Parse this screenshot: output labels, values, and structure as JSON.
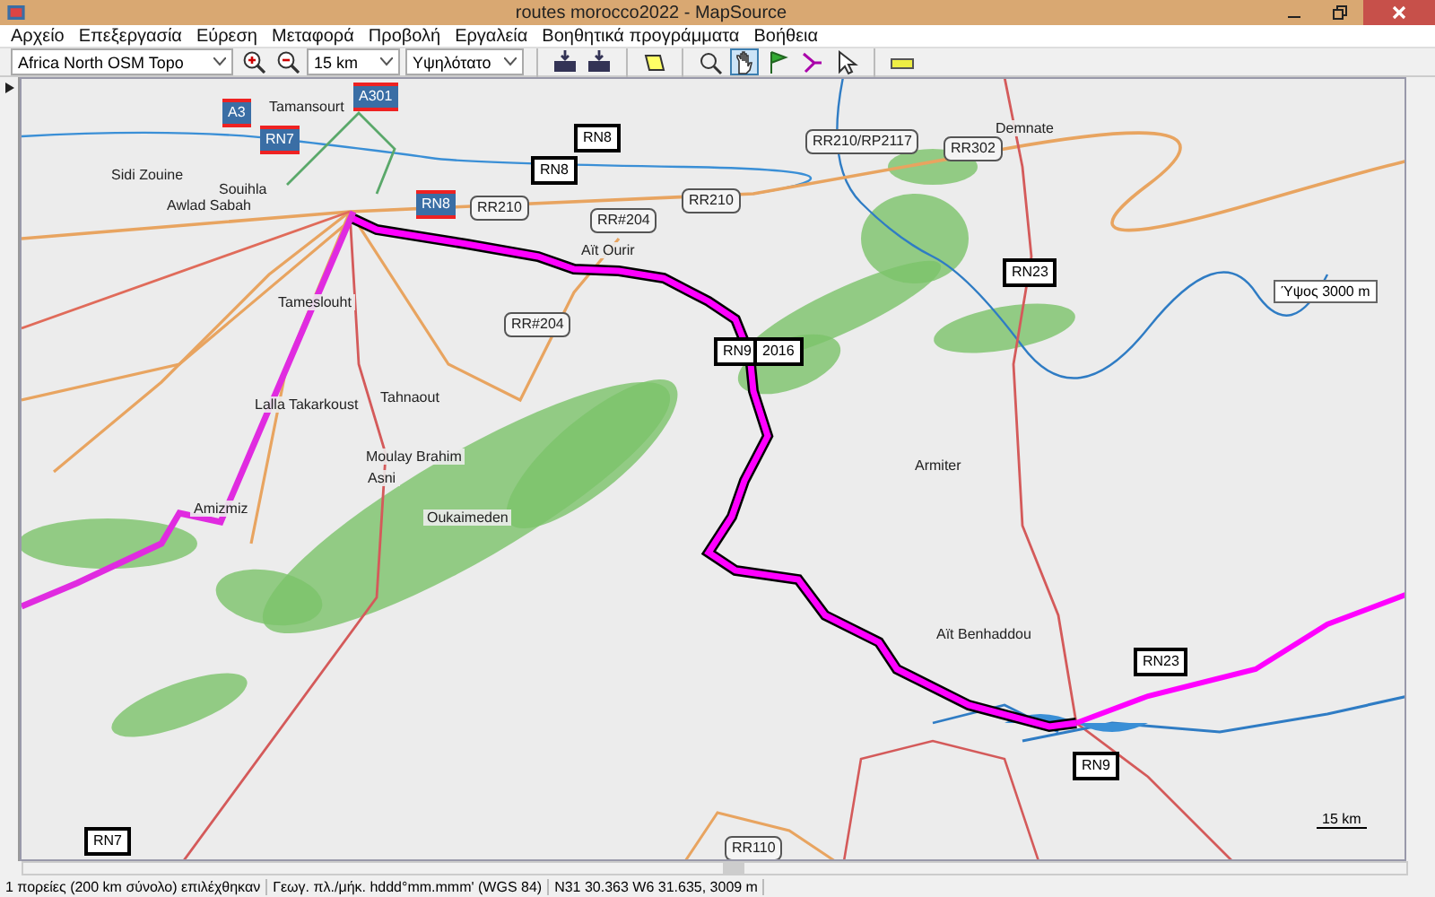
{
  "window": {
    "title": "routes morocco2022 - MapSource"
  },
  "menu": [
    "Αρχείο",
    "Επεξεργασία",
    "Εύρεση",
    "Μεταφορά",
    "Προβολή",
    "Εργαλεία",
    "Βοηθητικά προγράμματα",
    "Βοήθεια"
  ],
  "toolbar": {
    "map_product": "Africa North OSM Topo",
    "zoom": "15 km",
    "detail": "Υψηλότατο",
    "tools": [
      {
        "kind": "select-map",
        "selected": false
      },
      {
        "kind": "zoom",
        "selected": false
      },
      {
        "kind": "pan",
        "selected": true
      },
      {
        "kind": "waypoint",
        "selected": false
      },
      {
        "kind": "route",
        "selected": false
      },
      {
        "kind": "pointer",
        "selected": false
      },
      {
        "kind": "measure",
        "selected": false
      }
    ]
  },
  "map": {
    "places": [
      {
        "name": "Tamansourt"
      },
      {
        "name": "Sidi Zouine"
      },
      {
        "name": "Souihla"
      },
      {
        "name": "Awlad Sabah"
      },
      {
        "name": "Tameslouht"
      },
      {
        "name": "Lalla Takarkoust"
      },
      {
        "name": "Tahnaout"
      },
      {
        "name": "Moulay Brahim"
      },
      {
        "name": "Asni"
      },
      {
        "name": "Amizmiz"
      },
      {
        "name": "Oukaimeden"
      },
      {
        "name": "Aït Ourir"
      },
      {
        "name": "Demnate"
      },
      {
        "name": "Armiter"
      },
      {
        "name": "Aït Benhaddou"
      }
    ],
    "shields": [
      {
        "label": "A3",
        "kind": "motorway"
      },
      {
        "label": "A301",
        "kind": "motorway"
      },
      {
        "label": "RN7",
        "kind": "motorway"
      },
      {
        "label": "RN8",
        "kind": "motorway"
      },
      {
        "label": "RN8",
        "kind": "national"
      },
      {
        "label": "RN8",
        "kind": "national"
      },
      {
        "label": "RR210",
        "kind": "regional"
      },
      {
        "label": "RR#204",
        "kind": "regional"
      },
      {
        "label": "RR210",
        "kind": "regional"
      },
      {
        "label": "RR#204",
        "kind": "regional"
      },
      {
        "label": "RR210/RP2117",
        "kind": "regional"
      },
      {
        "label": "RR302",
        "kind": "regional"
      },
      {
        "label": "RN23",
        "kind": "national"
      },
      {
        "label": "RN9",
        "kind": "national"
      },
      {
        "label": "2016",
        "kind": "national"
      },
      {
        "label": "RN23",
        "kind": "national"
      },
      {
        "label": "RN9",
        "kind": "national"
      },
      {
        "label": "RN7",
        "kind": "national"
      },
      {
        "label": "RR110",
        "kind": "regional"
      }
    ],
    "tooltip": "Ύψος 3000 m",
    "scale": "15 km"
  },
  "status_bar": [
    "1 πορείες (200 km σύνολο) επιλέχθηκαν",
    "Γεωγ. πλ./μήκ. hddd°mm.mmm' (WGS 84)",
    "N31 30.363 W6 31.635, 3009 m"
  ]
}
